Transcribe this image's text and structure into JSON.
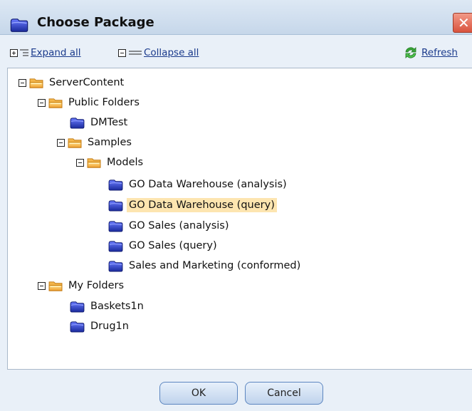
{
  "dialog": {
    "title": "Choose Package",
    "close_glyph": "✕"
  },
  "toolbar": {
    "expand_all": "Expand all",
    "collapse_all": "Collapse all",
    "refresh": "Refresh"
  },
  "tree": {
    "root": "ServerContent",
    "public_folders": "Public Folders",
    "dmtest": "DMTest",
    "samples": "Samples",
    "models": "Models",
    "go_dw_analysis": "GO Data Warehouse (analysis)",
    "go_dw_query": "GO Data Warehouse (query)",
    "go_sales_analysis": "GO Sales (analysis)",
    "go_sales_query": "GO Sales (query)",
    "sales_marketing": "Sales and Marketing (conformed)",
    "my_folders": "My Folders",
    "baskets": "Baskets1n",
    "drug": "Drug1n",
    "selected": "GO Data Warehouse (query)"
  },
  "footer": {
    "ok": "OK",
    "cancel": "Cancel"
  },
  "colors": {
    "selection": "#fde5b0",
    "link": "#1a3a8c",
    "package_blue": "#2a3fbf",
    "folder_orange": "#f3a93a"
  },
  "icons": [
    "package-icon",
    "folder-icon",
    "expand-all-icon",
    "collapse-all-icon",
    "refresh-icon",
    "close-icon"
  ]
}
